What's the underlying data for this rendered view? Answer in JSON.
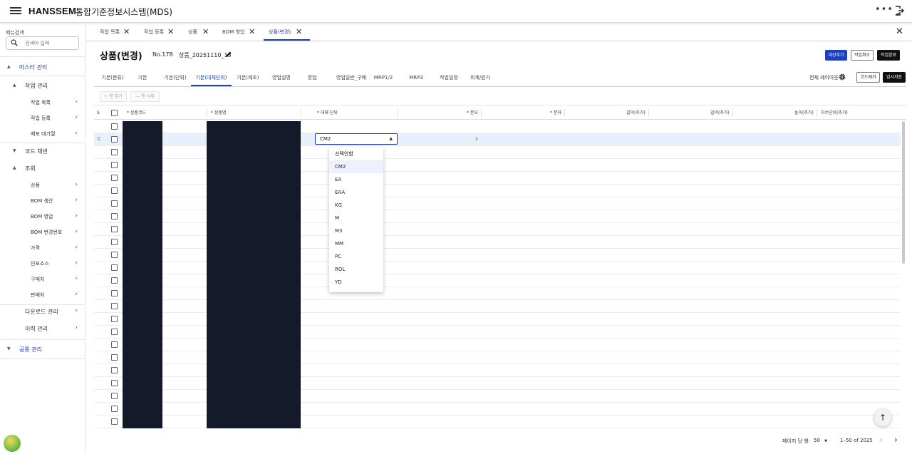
{
  "app": {
    "logo": "HANSSEM",
    "title": "통합기준정보시스템(MDS)",
    "more": "•••"
  },
  "sidebar": {
    "search_label": "메뉴검색",
    "search_placeholder": "검색어 입력",
    "items": [
      {
        "label": "마스터 관리"
      },
      {
        "label": "작업 관리"
      },
      {
        "label": "작업 목록"
      },
      {
        "label": "작업 등록"
      },
      {
        "label": "배포 대기열"
      },
      {
        "label": "코드 채번"
      },
      {
        "label": "조회"
      },
      {
        "label": "상품"
      },
      {
        "label": "BOM 생산"
      },
      {
        "label": "BOM 영업"
      },
      {
        "label": "BOM 변경번호"
      },
      {
        "label": "가격"
      },
      {
        "label": "인포소스"
      },
      {
        "label": "구매처"
      },
      {
        "label": "판매처"
      },
      {
        "label": "다운로드 관리"
      },
      {
        "label": "이력 관리"
      },
      {
        "label": "공통 관리"
      }
    ]
  },
  "tabs": [
    {
      "label": "작업 목록"
    },
    {
      "label": "작업 등록"
    },
    {
      "label": "상품"
    },
    {
      "label": "BOM 영업"
    },
    {
      "label": "상품(변경)"
    }
  ],
  "page": {
    "title": "상품(변경)",
    "no": "No.178",
    "code": "상품_20251110_13",
    "buttons": {
      "add_target": "대상추가",
      "cancel_work": "작업취소",
      "complete_work": "작업완료"
    }
  },
  "subtabs": [
    {
      "label": "기본(분류)"
    },
    {
      "label": "기본"
    },
    {
      "label": "기본(단위)"
    },
    {
      "label": "기본(대체단위)"
    },
    {
      "label": "기본(제조)"
    },
    {
      "label": "영업설명"
    },
    {
      "label": "영업"
    },
    {
      "label": "영업일반_구매"
    },
    {
      "label": "MRP1/2"
    },
    {
      "label": "MRP3"
    },
    {
      "label": "작업일정"
    },
    {
      "label": "회계/원가"
    }
  ],
  "layout_label": "전체 레이아웃",
  "code_remove": "코드제거",
  "temp_save": "임시저장",
  "toolbar": {
    "add_row": "+ 행 추가",
    "delete_row": "— 행 삭제"
  },
  "grid": {
    "columns": {
      "s": "S",
      "product_code": "* 상품코드",
      "product_name": "* 상품명",
      "alt_unit": "* 대체 단위",
      "denominator": "* 분모",
      "numerator": "* 분자",
      "length1": "길이(추가)",
      "length2": "길이(추가)",
      "height": "높이(추가)",
      "dim_unit": "치수단위(추가)"
    },
    "selected_row": {
      "status": "C",
      "alt_unit": "CM2",
      "denominator": "2"
    }
  },
  "dropdown_options": [
    "선택안함",
    "CM2",
    "EA",
    "EAA",
    "KG",
    "M",
    "M3",
    "MM",
    "PC",
    "ROL",
    "YD"
  ],
  "footer": {
    "rows_per_page_label": "페이지 당 행:",
    "rows_per_page": "50",
    "range": "1–50 of 2025"
  }
}
